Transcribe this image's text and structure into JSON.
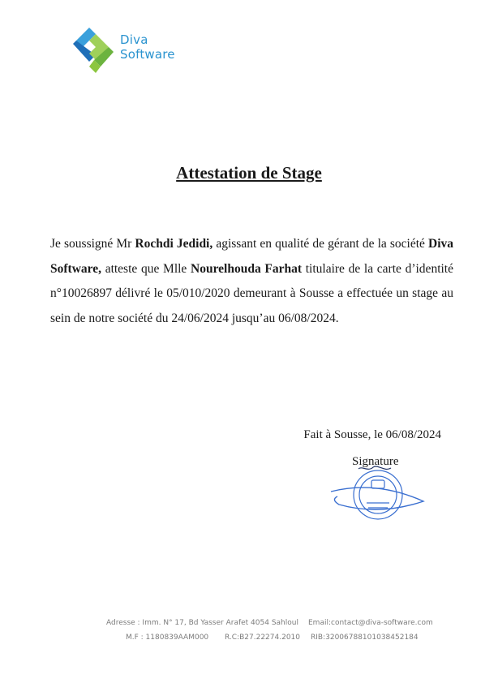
{
  "logo": {
    "line1": "Diva",
    "line2": "Software"
  },
  "title": "Attestation de Stage",
  "body": {
    "p1": "Je soussigné Mr ",
    "manager": "Rochdi Jedidi,",
    "p2": " agissant en qualité de gérant de la société ",
    "company": "Diva Software,",
    "p3": " atteste que Mlle ",
    "intern": "Nourelhouda Farhat",
    "p4": " titulaire de la carte d’identité n°10026897 délivré le 05/010/2020 demeurant à Sousse a effectuée un stage au sein de notre société du 24/06/2024 jusqu’au 06/08/2024."
  },
  "place_date": "Fait à Sousse, le 06/08/2024",
  "signature_label": "Signature",
  "footer": {
    "address": "Adresse :  Imm. N° 17, Bd Yasser Arafet 4054 Sahloul",
    "email": "Email:contact@diva-software.com",
    "mf": "M.F : 1180839AAM000",
    "rc": "R.C:B27.22274.2010",
    "rib": "RIB:32006788101038452184"
  },
  "colors": {
    "brand": "#2a93cf",
    "logo_green": "#8cc63f",
    "stamp": "#3a6fd0"
  }
}
